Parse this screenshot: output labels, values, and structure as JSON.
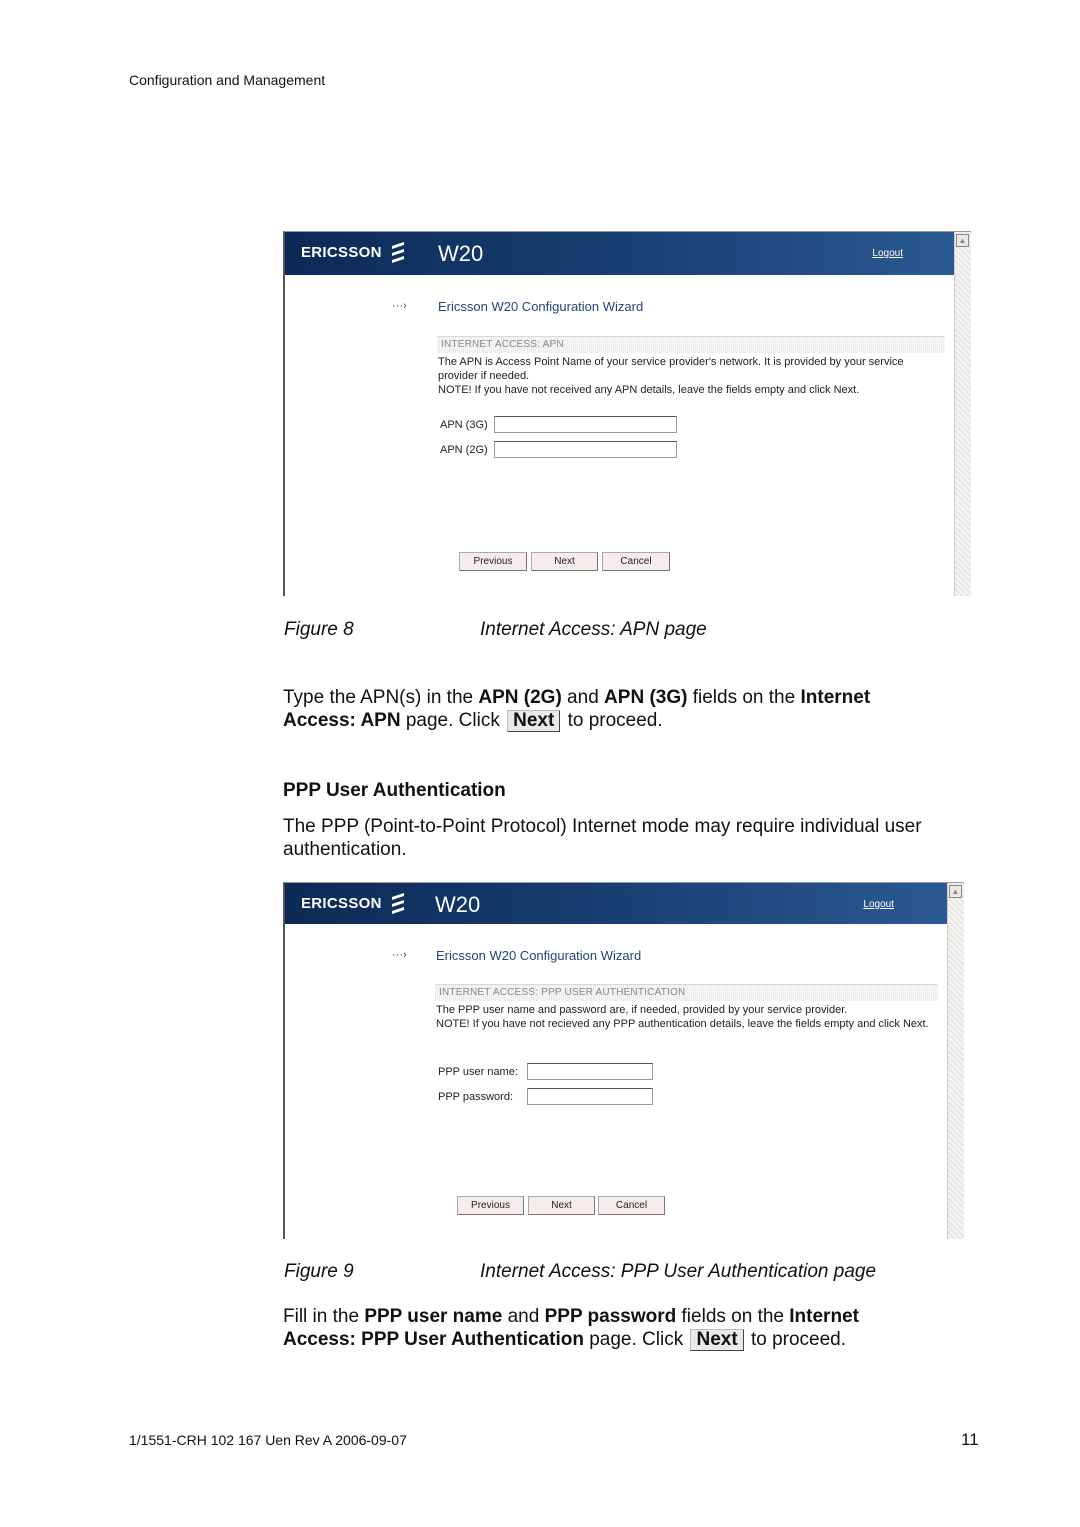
{
  "document": {
    "running_header": "Configuration and Management",
    "footer_doc_id": "1/1551-CRH 102 167 Uen Rev A  2006-09-07",
    "page_number": "11"
  },
  "screens": [
    {
      "brand": "ERICSSON",
      "product": "W20",
      "logout": "Logout",
      "wizard_title": "Ericsson W20 Configuration Wizard",
      "section_title": "INTERNET ACCESS: APN",
      "description_lines": [
        "The APN is Access Point Name of your service provider's network. It is provided by your service provider if needed.",
        "NOTE! If you have not received any APN details, leave the fields empty and click Next."
      ],
      "fields": [
        {
          "label": "APN (3G)",
          "value": ""
        },
        {
          "label": "APN (2G)",
          "value": ""
        }
      ],
      "buttons": {
        "previous": "Previous",
        "next": "Next",
        "cancel": "Cancel"
      }
    },
    {
      "brand": "ERICSSON",
      "product": "W20",
      "logout": "Logout",
      "wizard_title": "Ericsson W20 Configuration Wizard",
      "section_title": "INTERNET ACCESS: PPP USER AUTHENTICATION",
      "description_lines": [
        "The PPP user name and password are, if needed, provided by your service provider.",
        "NOTE! If you have not recieved any PPP authentication details, leave the fields empty and click Next."
      ],
      "fields": [
        {
          "label": "PPP user name:",
          "value": ""
        },
        {
          "label": "PPP password:",
          "value": ""
        }
      ],
      "buttons": {
        "previous": "Previous",
        "next": "Next",
        "cancel": "Cancel"
      }
    }
  ],
  "figure8": {
    "number": "Figure 8",
    "title": "Internet Access: APN page"
  },
  "para1": {
    "t1": "Type the APN(s) in the ",
    "b1": "APN (2G)",
    "t2": " and ",
    "b2": "APN (3G)",
    "t3": " fields on the ",
    "b3": "Internet Access: APN",
    "t4": " page. Click ",
    "key": "Next",
    "t5": " to proceed."
  },
  "section_heading": "PPP User Authentication",
  "para2": "The PPP (Point-to-Point Protocol) Internet mode may require individual user authentication.",
  "figure9": {
    "number": "Figure 9",
    "title": "Internet Access: PPP User Authentication page"
  },
  "para3": {
    "t1": "Fill in the ",
    "b1": "PPP user name",
    "t2": " and ",
    "b2": "PPP password",
    "t3": " fields on the ",
    "b3": "Internet Access: PPP User Authentication",
    "t4": " page. Click ",
    "key": "Next",
    "t5": " to proceed."
  }
}
